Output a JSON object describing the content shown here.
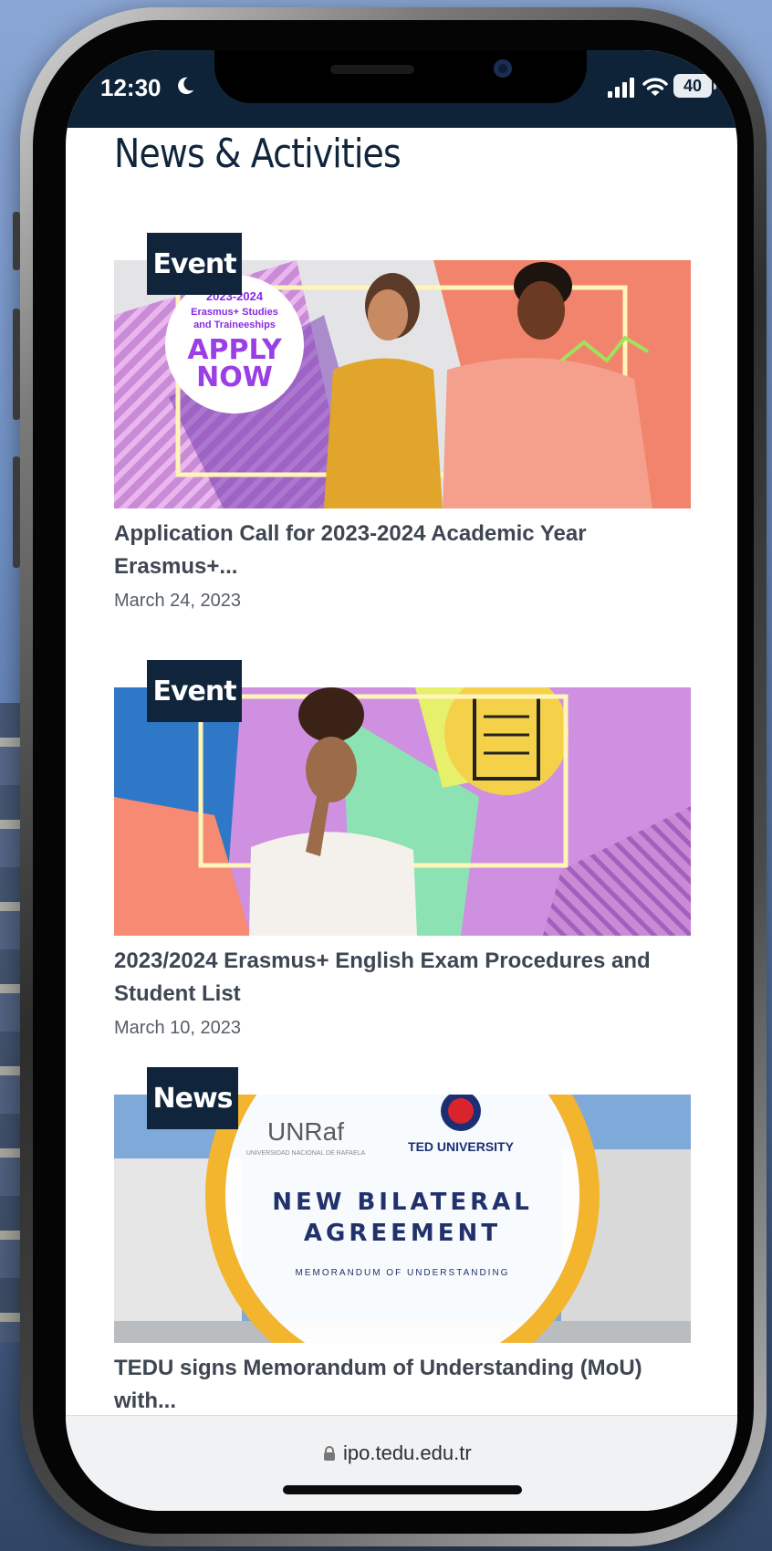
{
  "status_bar": {
    "time": "12:30",
    "battery_level": "40",
    "icons": [
      "moon-icon",
      "signal-icon",
      "wifi-icon",
      "battery-icon"
    ]
  },
  "page": {
    "title": "News & Activities"
  },
  "cards": [
    {
      "category": "Event",
      "title": "Application Call for 2023-2024 Academic Year Erasmus+...",
      "date": "March 24, 2023",
      "image_text": {
        "year": "2023-2024",
        "line1": "Erasmus+ Studies",
        "line2": "and Traineeships",
        "apply": "APPLY",
        "now": "NOW"
      }
    },
    {
      "category": "Event",
      "title": "2023/2024 Erasmus+ English Exam Procedures and Student List",
      "date": "March 10, 2023"
    },
    {
      "category": "News",
      "title": "TEDU signs Memorandum of Understanding (MoU) with...",
      "image_text": {
        "logo_left": "UNRaf",
        "logo_left_sub": "UNIVERSIDAD NACIONAL DE RAFAELA",
        "logo_right": "TED UNIVERSITY",
        "headline1": "NEW BILATERAL",
        "headline2": "AGREEMENT",
        "subline": "MEMORANDUM OF UNDERSTANDING"
      }
    }
  ],
  "url_bar": {
    "url": "ipo.tedu.edu.tr"
  },
  "colors": {
    "header_navy": "#0f2338",
    "badge_navy": "#10253b",
    "body_text": "#3d4652"
  }
}
